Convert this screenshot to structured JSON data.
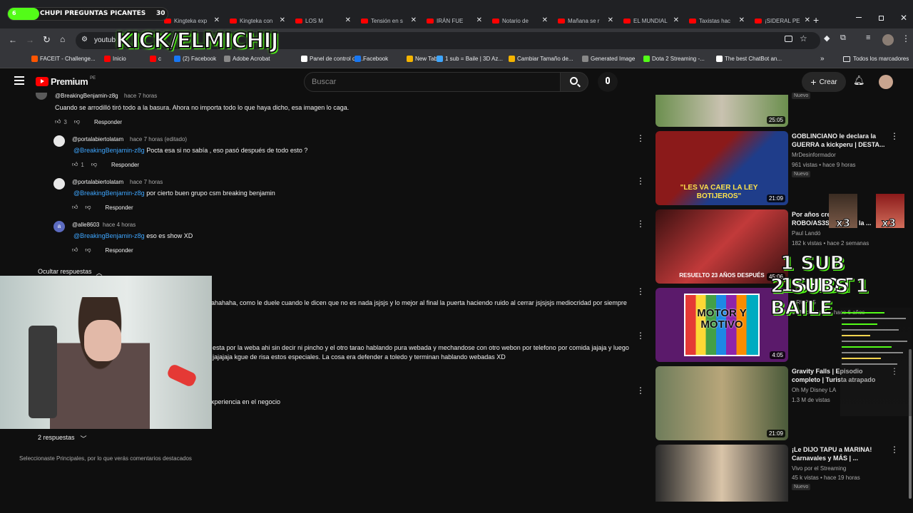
{
  "browser": {
    "tabs": [
      {
        "label": "Kingteka exp"
      },
      {
        "label": "Kingteka con"
      },
      {
        "label": "LOS M"
      },
      {
        "label": "Tensión en s"
      },
      {
        "label": "IRÁN FUE"
      },
      {
        "label": "Notario de"
      },
      {
        "label": "Mañana se r"
      },
      {
        "label": "EL MUNDIAL"
      },
      {
        "label": "Taxistas hac"
      },
      {
        "label": "¡SIDERAL PE"
      }
    ],
    "new_tab": "+",
    "url": "youtub",
    "bookmarks": [
      {
        "label": "FACEIT - Challenge...",
        "color": "#ff5500"
      },
      {
        "label": "Inicio",
        "color": "#ff0000"
      },
      {
        "label": "c",
        "color": "#ff0000"
      },
      {
        "label": "(2) Facebook",
        "color": "#1877f2"
      },
      {
        "label": "Adobe Acrobat",
        "color": "#888888"
      },
      {
        "label": "Panel de control del...",
        "color": "#ffffff"
      },
      {
        "label": "Facebook",
        "color": "#1877f2"
      },
      {
        "label": "New Tab",
        "color": "#f4b400"
      },
      {
        "label": "1 sub = Baile | 3D Az...",
        "color": "#3ea6ff"
      },
      {
        "label": "Cambiar Tamaño de...",
        "color": "#f4b400"
      },
      {
        "label": "Generated Image",
        "color": "#888888"
      },
      {
        "label": "Dota 2 Streaming -...",
        "color": "#53fc18"
      },
      {
        "label": "The best ChatBot an...",
        "color": "#ffffff"
      }
    ],
    "all_bookmarks": "Todos los marcadores"
  },
  "overlay": {
    "goal_label": "CHUPI PREGUNTAS PICANTES",
    "goal_start": "6",
    "goal_count": "30",
    "channel": "KICK/ELMICHIJ",
    "promo_line1": "1 SUB  1SHOT",
    "promo_line2": "2 SUBS 1 BAILE",
    "mult1": "x3",
    "mult2": "x3"
  },
  "youtube": {
    "logo": "Premium",
    "logo_region": "PE",
    "search_placeholder": "Buscar",
    "create_label": "Crear"
  },
  "comments": [
    {
      "handle": "@BreakingBenjamin-z8g",
      "time": "hace 7 horas",
      "text": "Cuando se arrodilló  tiró todo a la basura. Ahora no importa todo lo que haya dicho, esa imagen lo caga.",
      "likes": "3",
      "reply": "Responder"
    },
    {
      "handle": "@portalabiertolatam",
      "time": "hace 7 horas (editado)",
      "mention": "@BreakingBenjamin-z8g",
      "text": " Pocta esa si no sabía , eso pasó después de todo esto ?",
      "likes": "1",
      "reply": "Responder"
    },
    {
      "handle": "@portalabiertolatam",
      "time": "hace 7 horas",
      "mention": "@BreakingBenjamin-z8g",
      "text": " por cierto buen grupo csm breaking benjamin",
      "likes": "",
      "reply": "Responder"
    },
    {
      "handle": "@alle8603",
      "time": "hace 4 horas",
      "mention": "@BreakingBenjamin-z8g",
      "text": " eso es show XD",
      "likes": "",
      "reply": "Responder"
    }
  ],
  "hide_replies": "Ocultar respuestas",
  "partial_comments": [
    {
      "text": "ahahaha, como le duele cuando le dicen que no es nada jsjsjs y lo mejor al final la puerta haciendo ruido al cerrar jsjsjsjs mediocridad por siempre"
    },
    {
      "text": "esta por la weba ahi sin decir ni pincho y el otro tarao hablando pura webada y mechandose con otro webon por telefono por comida jajaja y luego"
    },
    {
      "text": "jajajaja kgue de risa estos especiales. La cosa era defender a toledo y terminan hablando webadas XD"
    },
    {
      "text": "xperiencia en el negocio"
    }
  ],
  "replies_toggle": "2 respuestas",
  "footer_note": "Seleccionaste Principales, por lo que verás comentarios destacados",
  "sidebar_videos": [
    {
      "title": "",
      "channel": "",
      "stats": "",
      "badge": "Nuevo",
      "duration": "25:05",
      "colors": [
        "#6b8f4e",
        "#c9c2b0"
      ]
    },
    {
      "title": "GOBLINCIANO le declara la GUERRA  a kickperu  | DESTA...",
      "channel": "MrDesinformador",
      "stats": "961 vistas • hace 9 horas",
      "badge": "Nuevo",
      "duration": "21:09",
      "caption": "\"LES VA CAER LA LEY BOTIJEROS\"",
      "colors": [
        "#8b1a1a",
        "#1f3d8a"
      ]
    },
    {
      "title": "Por años cre... fue un ROBO/AS3SIN... pero la ...",
      "channel": "Paul Landó",
      "stats": "182 k vistas • hace 2 semanas",
      "badge": "",
      "duration": "45:06",
      "caption": "RESUELTO 23 AÑOS DESPUÉS",
      "colors": [
        "#3a1010",
        "#c23a3a"
      ]
    },
    {
      "title": "",
      "channel": "GRUPO5",
      "stats": "17 M de vistas • hace 6 años",
      "badge": "",
      "duration": "4:05",
      "caption": "MOTOR Y MOTIVO",
      "colors": [
        "#5b1a6b",
        "#e7d21a"
      ]
    },
    {
      "title": "Gravity Falls | Episodio completo | Turista atrapado",
      "channel": "Oh My Disney LA",
      "stats": "1.3 M de vistas",
      "badge": "",
      "duration": "21:09",
      "colors": [
        "#6e7c5a",
        "#b8a67a"
      ]
    },
    {
      "title": "¡Le DIJO TAPU a MARINA! Carnavales y MÁS | ...",
      "channel": "Vivo por el Streaming",
      "stats": "45 k vistas • hace 19 horas",
      "badge": "Nuevo",
      "duration": "",
      "colors": [
        "#2a2a2a",
        "#d9c4a8"
      ]
    }
  ]
}
